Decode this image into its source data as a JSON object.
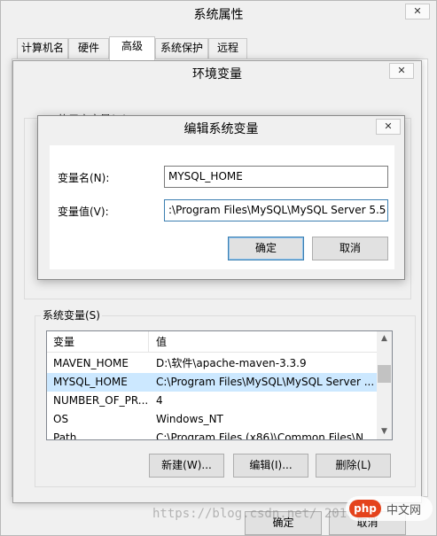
{
  "system_properties": {
    "title": "系统属性",
    "close_glyph": "✕",
    "tabs": [
      {
        "label": "计算机名",
        "active": false
      },
      {
        "label": "硬件",
        "active": false
      },
      {
        "label": "高级",
        "active": true
      },
      {
        "label": "系统保护",
        "active": false
      },
      {
        "label": "远程",
        "active": false
      }
    ],
    "ok_label": "确定",
    "cancel_label": "取消"
  },
  "environment_variables": {
    "title": "环境变量",
    "close_glyph": "✕",
    "user_vars_label": "的用户变量(U)",
    "system_vars_label": "系统变量(S)",
    "columns": [
      "变量",
      "值"
    ],
    "system_vars": [
      {
        "name": "MAVEN_HOME",
        "value": "D:\\软件\\apache-maven-3.3.9",
        "selected": false
      },
      {
        "name": "MYSQL_HOME",
        "value": "C:\\Program Files\\MySQL\\MySQL Server ...",
        "selected": true
      },
      {
        "name": "NUMBER_OF_PR...",
        "value": "4",
        "selected": false
      },
      {
        "name": "OS",
        "value": "Windows_NT",
        "selected": false
      },
      {
        "name": "Path",
        "value": "C:\\Program Files (x86)\\Common Files\\N...",
        "selected": false
      }
    ],
    "new_label": "新建(W)...",
    "edit_label": "编辑(I)...",
    "delete_label": "删除(L)"
  },
  "edit_system_variable": {
    "title": "编辑系统变量",
    "close_glyph": "✕",
    "name_label": "变量名(N):",
    "name_value": "MYSQL_HOME",
    "value_label": "变量值(V):",
    "value_value": ":\\Program Files\\MySQL\\MySQL Server 5.5",
    "ok_label": "确定",
    "cancel_label": "取消"
  },
  "scroll": {
    "up_glyph": "▲",
    "down_glyph": "▼"
  },
  "watermark": {
    "text": "https://blog.csdn.net/     2016",
    "logo_mark": "php",
    "logo_text": "中文网"
  }
}
